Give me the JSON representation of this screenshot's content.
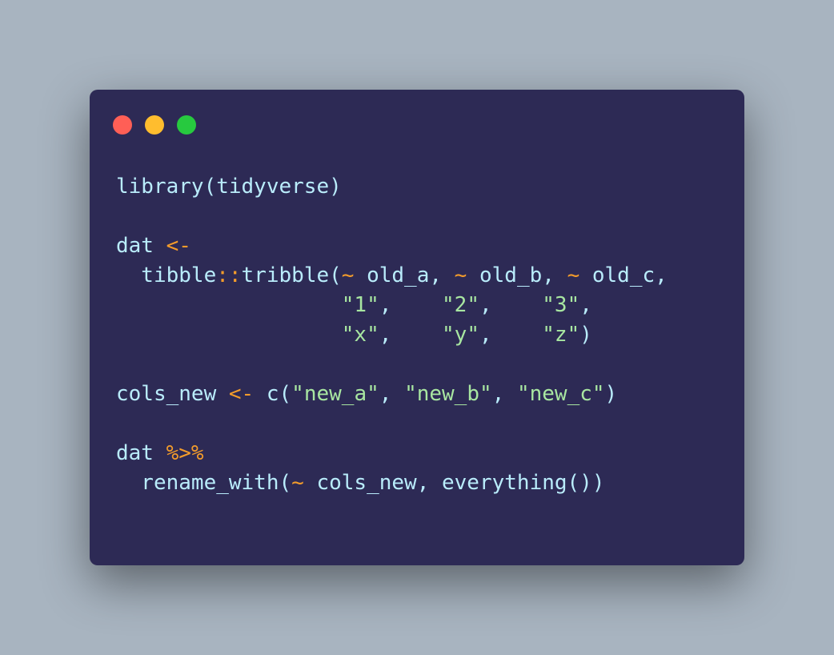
{
  "window": {
    "title_buttons": [
      "close",
      "minimize",
      "maximize"
    ],
    "background": "#2d2a55",
    "colors": {
      "close": "#ff5f56",
      "minimize": "#ffbd2e",
      "maximize": "#27c93f",
      "identifier": "#b9ecfb",
      "operator": "#f39c2b",
      "string": "#a8e6a1"
    }
  },
  "code": {
    "language": "R",
    "lines": [
      [
        {
          "type": "fn",
          "text": "library(tidyverse)"
        }
      ],
      [],
      [
        {
          "type": "fn",
          "text": "dat "
        },
        {
          "type": "op",
          "text": "<-"
        }
      ],
      [
        {
          "type": "fn",
          "text": "  tibble"
        },
        {
          "type": "op",
          "text": "::"
        },
        {
          "type": "fn",
          "text": "tribble("
        },
        {
          "type": "op",
          "text": "~"
        },
        {
          "type": "fn",
          "text": " old_a, "
        },
        {
          "type": "op",
          "text": "~"
        },
        {
          "type": "fn",
          "text": " old_b, "
        },
        {
          "type": "op",
          "text": "~"
        },
        {
          "type": "fn",
          "text": " old_c,"
        }
      ],
      [
        {
          "type": "fn",
          "text": "                  "
        },
        {
          "type": "str",
          "text": "\"1\""
        },
        {
          "type": "fn",
          "text": ",    "
        },
        {
          "type": "str",
          "text": "\"2\""
        },
        {
          "type": "fn",
          "text": ",    "
        },
        {
          "type": "str",
          "text": "\"3\""
        },
        {
          "type": "fn",
          "text": ","
        }
      ],
      [
        {
          "type": "fn",
          "text": "                  "
        },
        {
          "type": "str",
          "text": "\"x\""
        },
        {
          "type": "fn",
          "text": ",    "
        },
        {
          "type": "str",
          "text": "\"y\""
        },
        {
          "type": "fn",
          "text": ",    "
        },
        {
          "type": "str",
          "text": "\"z\""
        },
        {
          "type": "fn",
          "text": ")"
        }
      ],
      [],
      [
        {
          "type": "fn",
          "text": "cols_new "
        },
        {
          "type": "op",
          "text": "<-"
        },
        {
          "type": "fn",
          "text": " c("
        },
        {
          "type": "str",
          "text": "\"new_a\""
        },
        {
          "type": "fn",
          "text": ", "
        },
        {
          "type": "str",
          "text": "\"new_b\""
        },
        {
          "type": "fn",
          "text": ", "
        },
        {
          "type": "str",
          "text": "\"new_c\""
        },
        {
          "type": "fn",
          "text": ")"
        }
      ],
      [],
      [
        {
          "type": "fn",
          "text": "dat "
        },
        {
          "type": "op",
          "text": "%>%"
        }
      ],
      [
        {
          "type": "fn",
          "text": "  rename_with("
        },
        {
          "type": "op",
          "text": "~"
        },
        {
          "type": "fn",
          "text": " cols_new, everything())"
        }
      ]
    ]
  }
}
